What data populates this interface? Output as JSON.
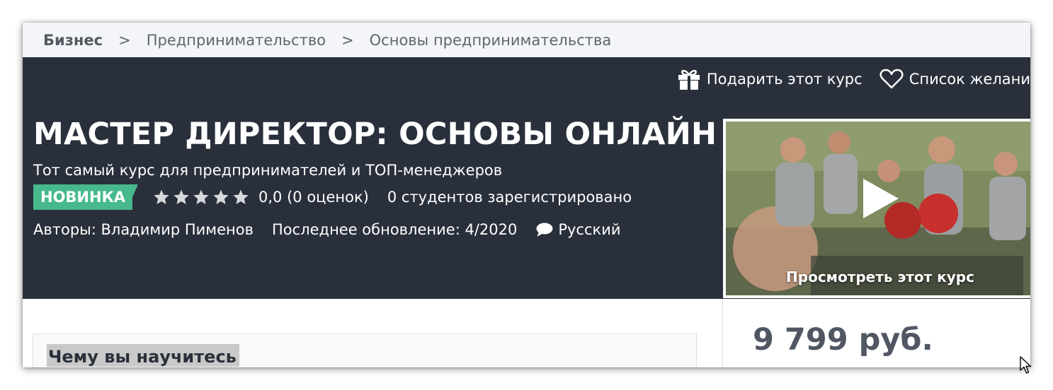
{
  "breadcrumb": {
    "items": [
      "Бизнес",
      "Предпринимательство",
      "Основы предпринимательства"
    ],
    "separator": ">"
  },
  "actions": {
    "gift_label": "Подарить этот курс",
    "gift_icon": "gift-icon",
    "wishlist_label": "Список желани",
    "wishlist_icon": "heart-icon"
  },
  "course": {
    "title": "МАСТЕР ДИРЕКТОР: ОСНОВЫ ОНЛАЙН",
    "subtitle": "Тот самый курс для предпринимателей и ТОП-менеджеров",
    "badge": "НОВИНКА",
    "stars": 0,
    "rating_text": "0,0 (0 оценок)",
    "students_text": "0 студентов зарегистрировано",
    "authors_text": "Авторы: Владимир Пименов",
    "updated_text": "Последнее обновление: 4/2020",
    "language": "Русский"
  },
  "preview": {
    "label": "Просмотреть этот курс",
    "icon": "play-icon"
  },
  "learn": {
    "title": "Чему вы научитесь"
  },
  "pricing": {
    "price": "9 799 руб."
  },
  "colors": {
    "hero_bg": "#29303b",
    "badge_bg": "#47b98c",
    "breadcrumb_bg": "#f4f5f8",
    "price_text": "#505763"
  }
}
